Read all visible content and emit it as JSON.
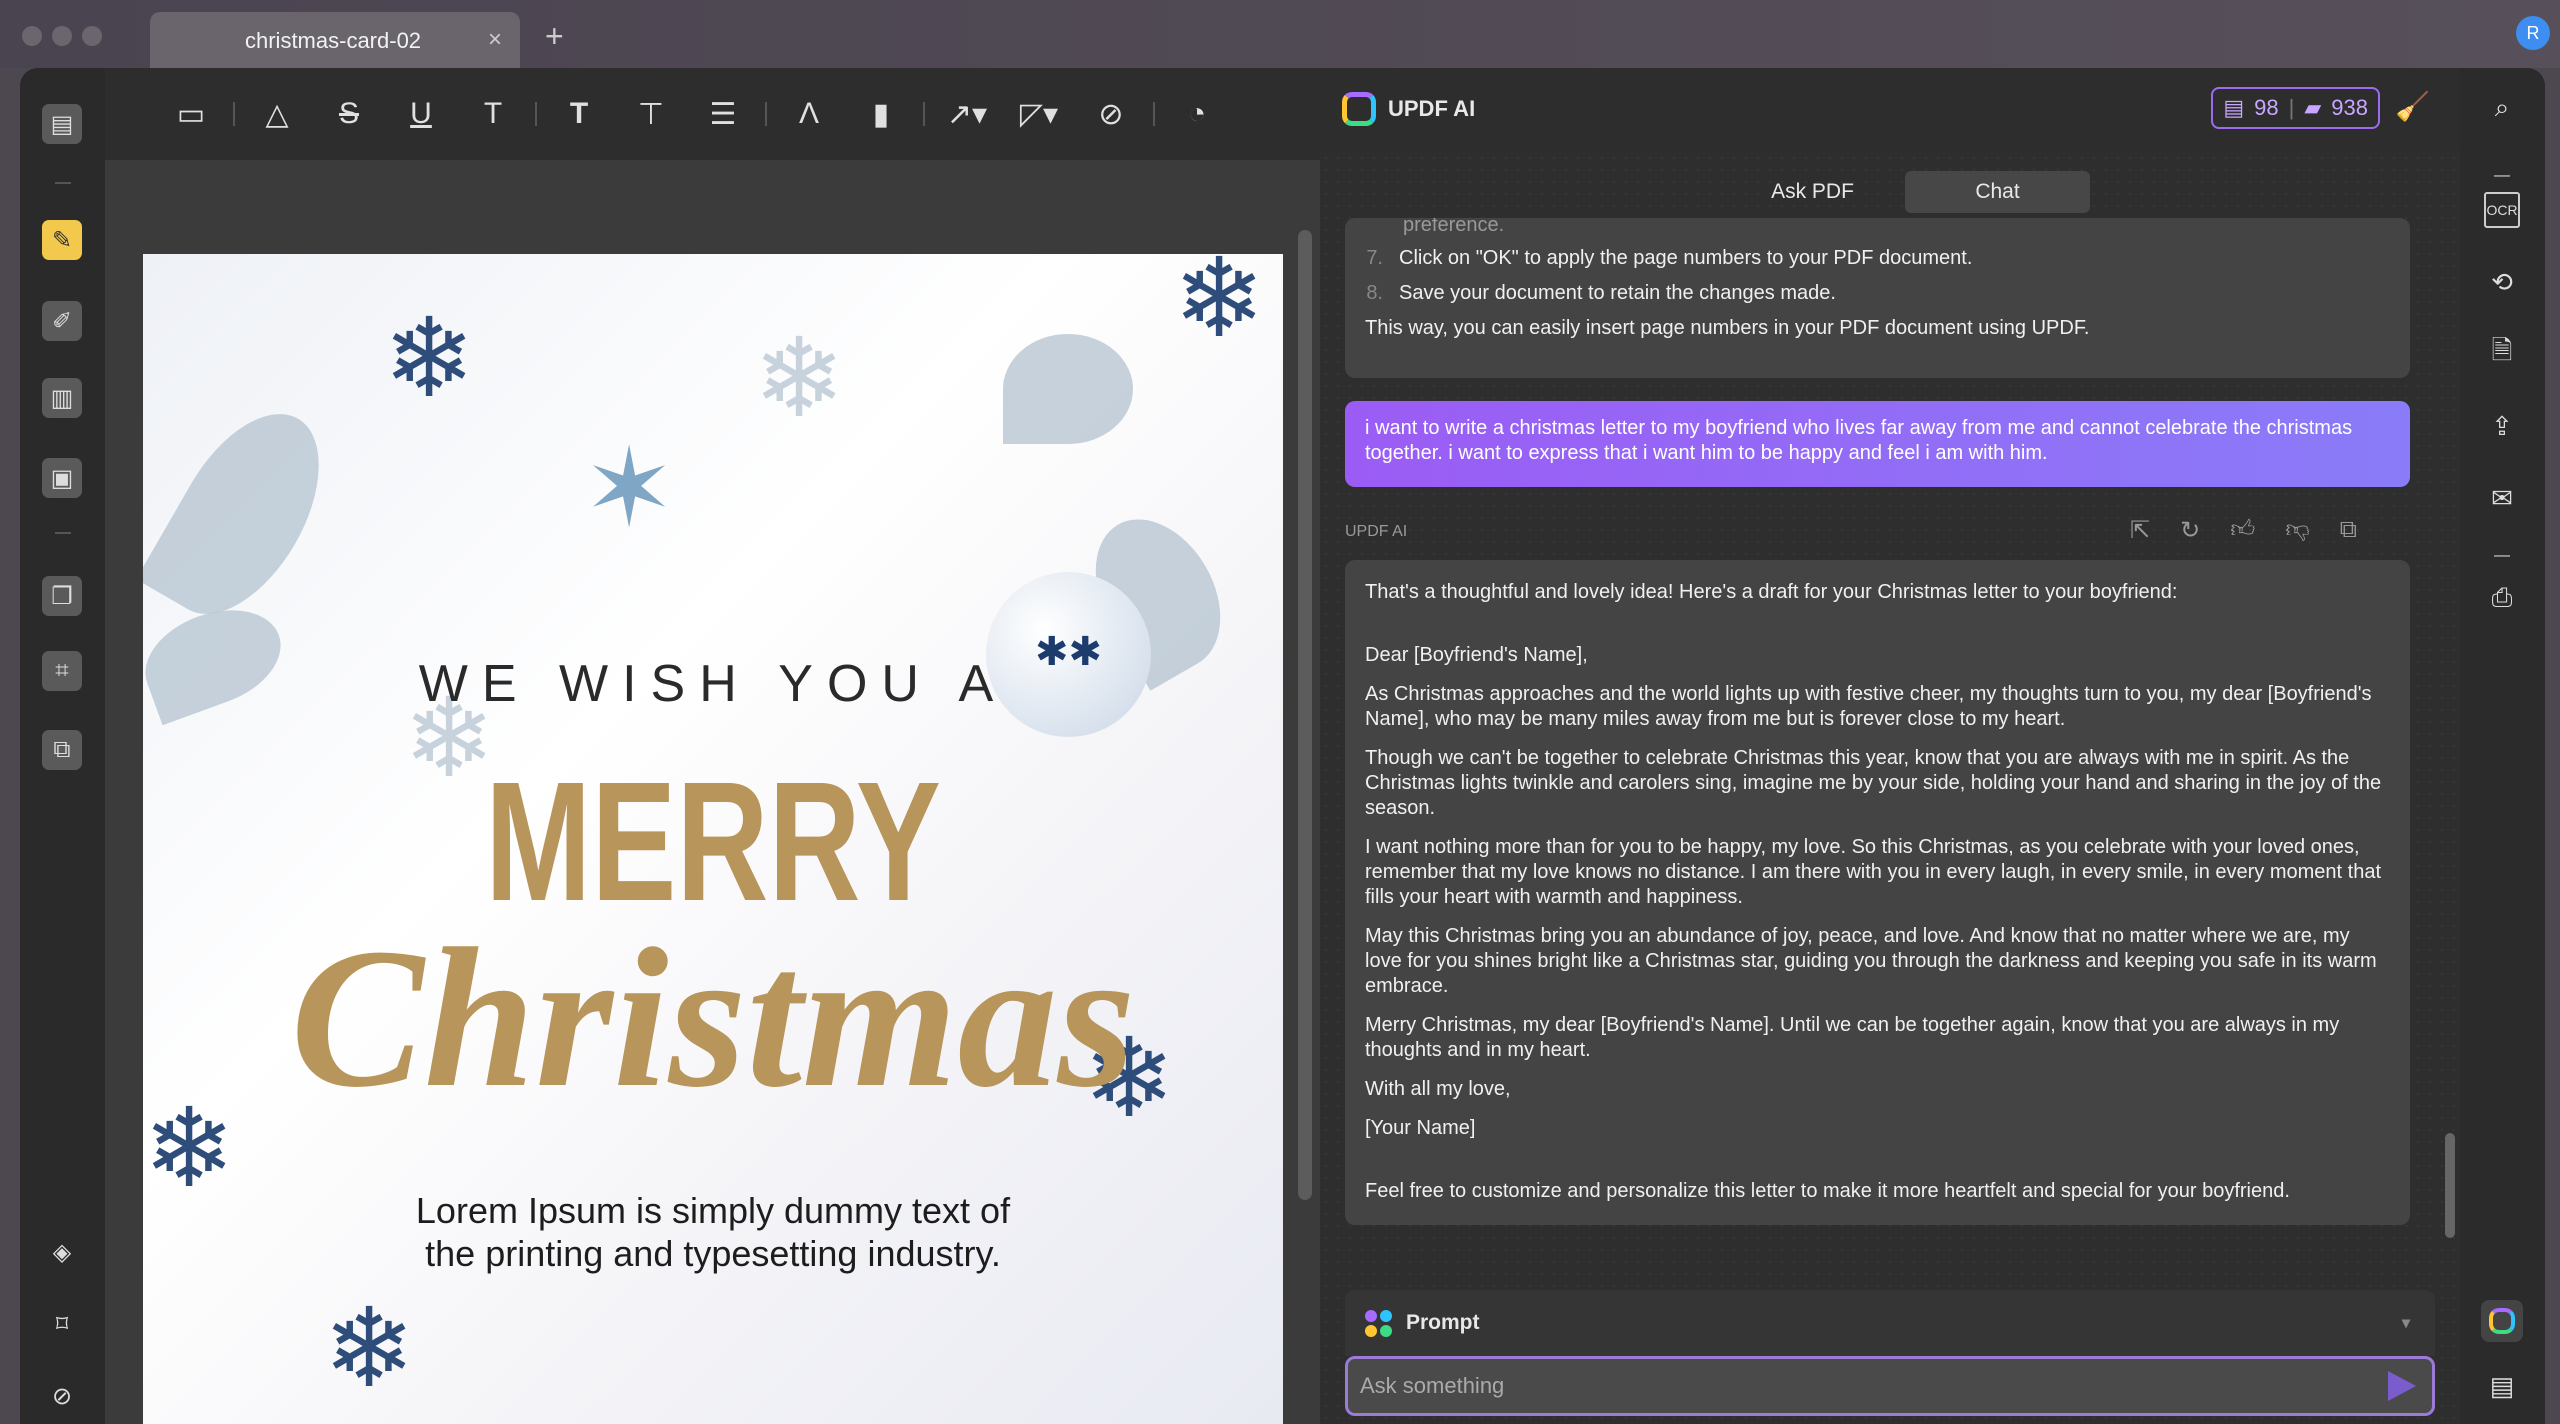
{
  "window": {
    "tab_title": "christmas-card-02",
    "tab_close": "×",
    "new_tab": "+",
    "avatar": "R"
  },
  "toolbar": {
    "icons": [
      "comment-icon",
      "highlight-icon",
      "strikethrough-icon",
      "underline-icon",
      "squiggly-icon",
      "text-icon",
      "textbox-icon",
      "text-callout-icon",
      "pencil-icon",
      "eraser-icon",
      "arrow-icon",
      "shape-icon",
      "attachment-icon",
      "sticker-icon"
    ]
  },
  "document": {
    "wish": "WE WISH YOU A",
    "merry": "MERRY",
    "christmas": "Christmas",
    "lorem": "Lorem Ipsum is simply dummy text of the printing and typesetting industry."
  },
  "ai": {
    "title": "UPDF AI",
    "doc_count": "98",
    "chat_count": "938",
    "tabs": [
      "Ask PDF",
      "Chat"
    ],
    "previous": {
      "cut_line": "preference.",
      "steps": [
        {
          "n": "7.",
          "text": "Click on \"OK\" to apply the page numbers to your PDF document."
        },
        {
          "n": "8.",
          "text": "Save your document to retain the changes made."
        }
      ],
      "closing": "This way, you can easily insert page numbers in your PDF document using UPDF."
    },
    "user_message": "i want to write a christmas letter to my boyfriend who lives far away from me and cannot celebrate the christmas together. i want to express that i want him to be happy and feel i am with him.",
    "response_label": "UPDF AI",
    "response": [
      "That's a thoughtful and lovely idea! Here's a draft for your Christmas letter to your boyfriend:",
      "Dear [Boyfriend's Name],",
      "As Christmas approaches and the world lights up with festive cheer, my thoughts turn to you, my dear [Boyfriend's Name], who may be many miles away from me but is forever close to my heart.",
      "Though we can't be together to celebrate Christmas this year, know that you are always with me in spirit. As the Christmas lights twinkle and carolers sing, imagine me by your side, holding your hand and sharing in the joy of the season.",
      "I want nothing more than for you to be happy, my love. So this Christmas, as you celebrate with your loved ones, remember that my love knows no distance. I am there with you in every laugh, in every smile, in every moment that fills your heart with warmth and happiness.",
      "May this Christmas bring you an abundance of joy, peace, and love. And know that no matter where we are, my love for you shines bright like a Christmas star, guiding you through the darkness and keeping you safe in its warm embrace.",
      "Merry Christmas, my dear [Boyfriend's Name]. Until we can be together again, know that you are always in my thoughts and in my heart.",
      "With all my love,",
      "[Your Name]",
      "Feel free to customize and personalize this letter to make it more heartfelt and special for your boyfriend."
    ],
    "prompt_label": "Prompt",
    "input_placeholder": "Ask something"
  },
  "colors": {
    "accent": "#9b6cf0",
    "gold": "#b8955a",
    "highlight_tool": "#f2c94c"
  }
}
